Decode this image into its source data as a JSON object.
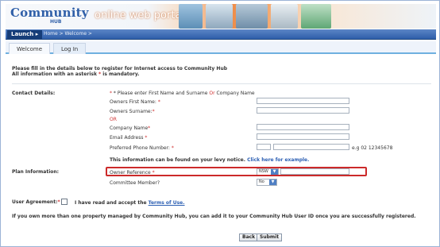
{
  "brand": {
    "name": "Community",
    "sub": "HUB",
    "portal_text": "online web portal"
  },
  "colors": {
    "primary": "#2e5ea9",
    "accent": "#ee8b47",
    "required": "#d03030",
    "highlight_border": "#cc2a2a"
  },
  "nav": {
    "launch": "Launch",
    "breadcrumb": "Home > Welcome >"
  },
  "tabs": [
    {
      "label": "Welcome"
    },
    {
      "label": "Log In"
    }
  ],
  "intro": {
    "line1": "Please fill in the details below to register for Internet access to Community Hub",
    "line2_pre": "All information with an asterisk ",
    "line2_post": " is mandatory.",
    "asterisk": "*"
  },
  "contact": {
    "section_label": "Contact Details:",
    "hint_pre": "* Please enter First Name and Surname ",
    "hint_or": "Or",
    "hint_post": " Company Name",
    "first_name_label": "Owners First Name:",
    "surname_label": "Owners Surname:",
    "or_label": "OR",
    "company_label": "Company Name",
    "email_label": "Email Address",
    "phone_label": "Preferred Phone Number:",
    "phone_example": "e.g 02 12345678",
    "levy_text": "This information can be found on your levy notice.",
    "levy_link": "Click here for example."
  },
  "plan": {
    "section_label": "Plan Information:",
    "owner_ref_label": "Owner Reference",
    "owner_ref_select": "NSW",
    "committee_label": "Committee Member?",
    "committee_select": "No"
  },
  "agreement": {
    "label": "User Agreement:",
    "text_pre": "I have read and accept the ",
    "terms_link": "Terms of Use."
  },
  "note": "If you own more than one property managed by Community Hub, you can add it to your Community Hub User ID once you are successfully registered.",
  "buttons": {
    "back": "Back",
    "submit": "Submit"
  }
}
